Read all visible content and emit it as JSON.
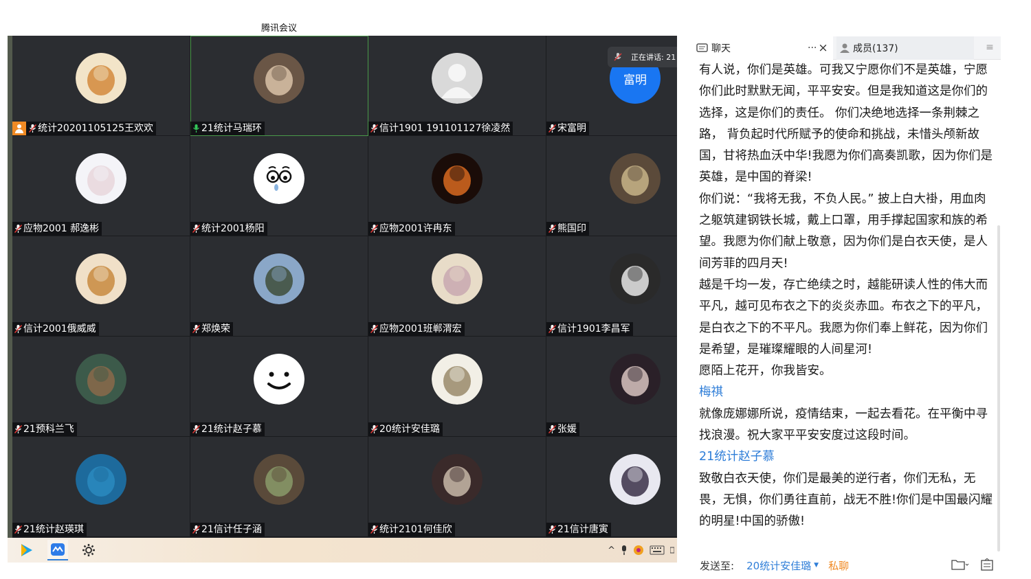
{
  "meeting": {
    "title": "腾讯会议",
    "speaking_label": "正在讲话: 21",
    "participants": [
      {
        "name": "统计20201105125王欢欢",
        "host": true
      },
      {
        "name": "21统计马瑞环",
        "active": true
      },
      {
        "name": "信计1901 191101127徐凌然"
      },
      {
        "name": "宋富明",
        "avatar_text": "富明"
      },
      {
        "name": "应物2001 郝逸彬"
      },
      {
        "name": "统计2001杨阳"
      },
      {
        "name": "应物2001许冉东"
      },
      {
        "name": "熊国印"
      },
      {
        "name": "信计2001俄威威"
      },
      {
        "name": "郑焕荣"
      },
      {
        "name": "应物2001班郸渭宏"
      },
      {
        "name": "信计1901李昌军"
      },
      {
        "name": "21预科兰飞"
      },
      {
        "name": "21统计赵子慕"
      },
      {
        "name": "20统计安佳璐"
      },
      {
        "name": "张媛"
      },
      {
        "name": "21统计赵瑛琪"
      },
      {
        "name": "21信计任子涵"
      },
      {
        "name": "统计2101何佳欣"
      },
      {
        "name": "21信计唐寅"
      }
    ]
  },
  "taskbar": {
    "icons": [
      "media-player-icon",
      "tencent-meeting-icon",
      "settings-icon"
    ],
    "tray_text": "^"
  },
  "chat_panel": {
    "tab_chat": "聊天",
    "tab_members": "成员(137)",
    "tab_more": "···",
    "tab_close": "×",
    "messages": [
      {
        "sender": "",
        "text": "有人说，你们是英雄。可我又宁愿你们不是英雄，宁愿你们此时默默无闻，平平安安。但是我知道这是你们的选择，这是你们的责任。 你们决绝地选择一条荆棘之路， 背负起时代所赋予的使命和挑战，未惜头颅新故国，甘将热血沃中华!我愿为你们高奏凯歌，因为你们是英雄，是中国的脊梁!"
      },
      {
        "sender": "",
        "text": "你们说：“我将无我，不负人民。” 披上白大褂，用血肉之躯筑建钢铁长城，戴上口罩，用手撑起国家和族的希望。我愿为你们献上敬意，因为你们是白衣天使，是人间芳菲的四月天!"
      },
      {
        "sender": "",
        "text": "越是千均一发，存亡绝续之时，越能研读人性的伟大而平凡，越可见布衣之下的炎炎赤皿。布衣之下的平凡，是白衣之下的不平凡。我愿为你们奉上鲜花，因为你们是希望，是璀璨耀眼的人间星河!"
      },
      {
        "sender": "",
        "text": "愿陌上花开，你我皆安。"
      },
      {
        "sender": "梅祺",
        "text": "就像庞娜娜所说，疫情结束，一起去看花。在平衡中寻找浪漫。祝大家平平安安度过这段时间。"
      },
      {
        "sender": "21统计赵子慕",
        "text": "致敬白衣天使，你们是最美的逆行者，你们无私，无畏，无惧，你们勇往直前，战无不胜!你们是中国最闪耀的明星!中国的骄傲!"
      }
    ],
    "send_label": "发送至:",
    "send_target": "20统计安佳璐",
    "send_private": "私聊"
  }
}
